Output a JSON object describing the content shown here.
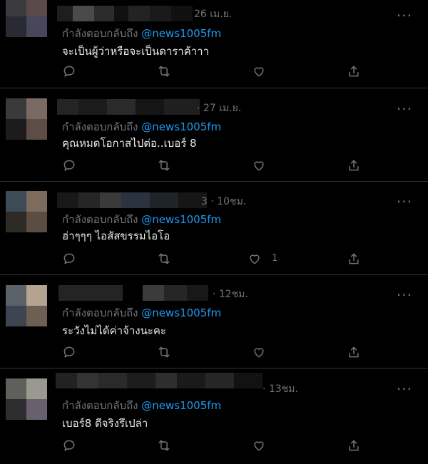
{
  "colors": {
    "background": "#000000",
    "handle": "#1d9bf0",
    "muted": "#6e767d",
    "text": "#e7e9ea"
  },
  "tweets": [
    {
      "time": "26 เม.ย.",
      "reply_prefix": "กำลังตอบกลับถึง",
      "handle": "@news1005fm",
      "text": "จะเป็นผู้ว่าหรือจะเป็นดาราค้าาา",
      "like_count": ""
    },
    {
      "time": "· 27 เม.ย.",
      "reply_prefix": "กำลังตอบกลับถึง",
      "handle": "@news1005fm",
      "text": "คุณหมดโอกาสไปต่อ..เบอร์ 8",
      "like_count": ""
    },
    {
      "time": "3 · 10ชม.",
      "reply_prefix": "กำลังตอบกลับถึง",
      "handle": "@news1005fm",
      "text": "ฮ่าๆๆๆ ไอสัสขรรมไอโอ",
      "like_count": "1"
    },
    {
      "time": "· 12ชม.",
      "reply_prefix": "กำลังตอบกลับถึง",
      "handle": "@news1005fm",
      "text": "ระวังไม่ได้ค่าจ้างนะคะ",
      "like_count": ""
    },
    {
      "time": "· 13ชม.",
      "reply_prefix": "กำลังตอบกลับถึง",
      "handle": "@news1005fm",
      "text": "เบอร์8 ดีจริงรึเปล่า",
      "like_count": ""
    }
  ],
  "icons": {
    "reply": "reply-icon",
    "retweet": "retweet-icon",
    "like": "like-icon",
    "share": "share-icon",
    "more": "more-icon"
  }
}
